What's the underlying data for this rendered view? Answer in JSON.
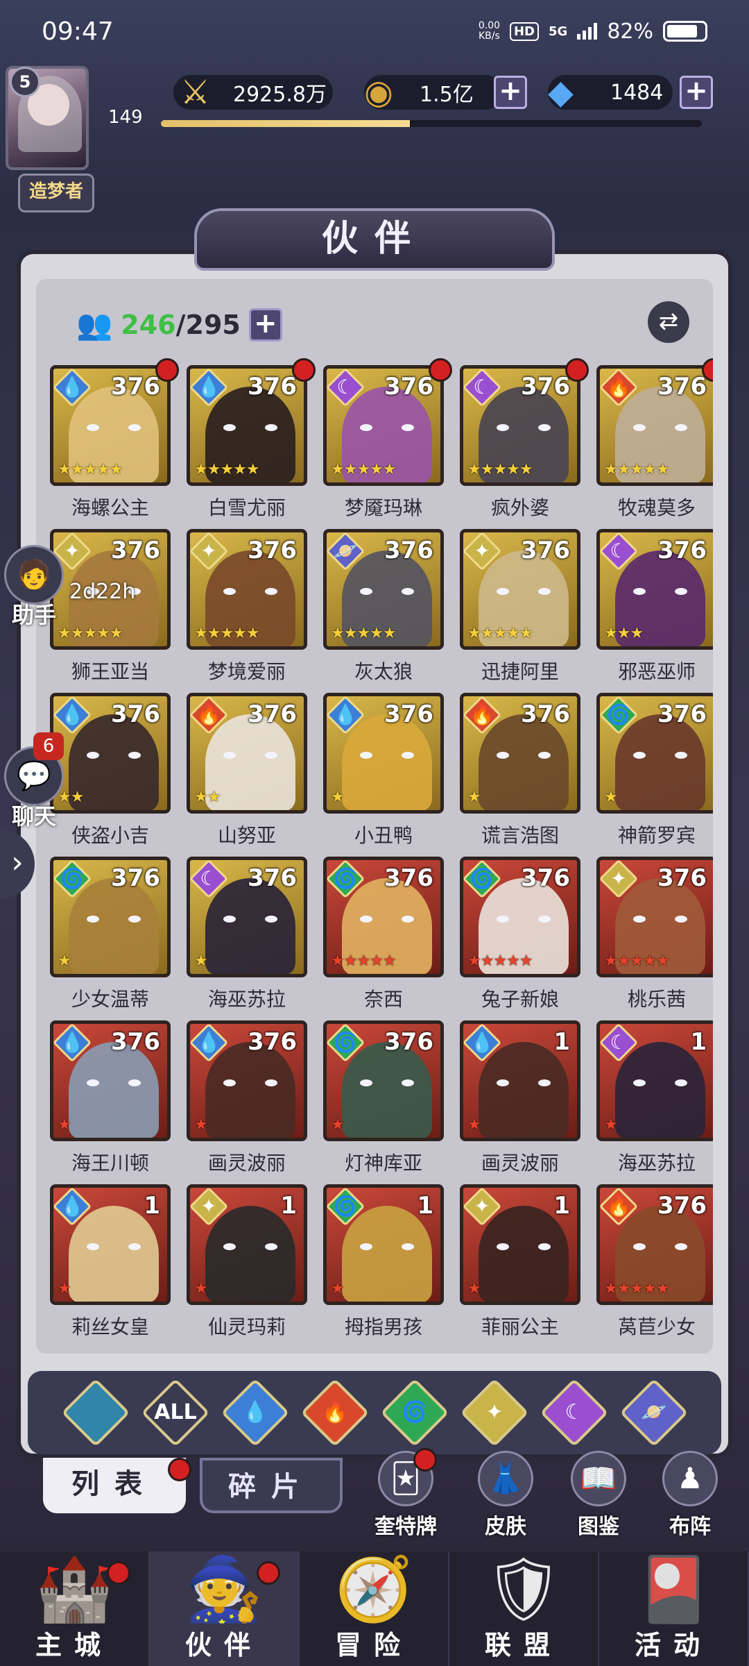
{
  "status_bar": {
    "time": "09:47",
    "speed_value": "0.00",
    "speed_unit": "KB/s",
    "hd": "HD",
    "network": "5G",
    "battery": "82%",
    "battery_level": 0.82
  },
  "player": {
    "level": "5",
    "xp_value": "149",
    "xp_progress": 0.46,
    "title": "造梦者"
  },
  "resources": {
    "power": "2925.8万",
    "gold": "1.5亿",
    "gems": "1484"
  },
  "panel": {
    "title": "伙伴",
    "owned": "246",
    "total": "/295"
  },
  "heroes": [
    {
      "name": "海螺公主",
      "level": "376",
      "stars": "★★★★★",
      "star_color": "y",
      "frame": "gold",
      "element": "water",
      "element_color": "#3d7fd6",
      "dot": true,
      "art": "#e0c07a"
    },
    {
      "name": "白雪尤丽",
      "level": "376",
      "stars": "★★★★★",
      "star_color": "y",
      "frame": "gold",
      "element": "water",
      "element_color": "#3d7fd6",
      "dot": true,
      "art": "#2a2020"
    },
    {
      "name": "梦魇玛琳",
      "level": "376",
      "stars": "★★★★★",
      "star_color": "y",
      "frame": "gold",
      "element": "dark",
      "element_color": "#9a4fd0",
      "dot": true,
      "art": "#9a55a6"
    },
    {
      "name": "疯外婆",
      "level": "376",
      "stars": "★★★★★",
      "star_color": "y",
      "frame": "gold",
      "element": "dark",
      "element_color": "#9a4fd0",
      "dot": true,
      "art": "#4a4450"
    },
    {
      "name": "牧魂莫多",
      "level": "376",
      "stars": "★★★★★",
      "star_color": "y",
      "frame": "gold",
      "element": "fire",
      "element_color": "#d8492b",
      "dot": true,
      "art": "#bfae96"
    },
    {
      "name": "狮王亚当",
      "level": "376",
      "stars": "★★★★★",
      "star_color": "y",
      "frame": "gold",
      "element": "light",
      "element_color": "#c9b44a",
      "dot": false,
      "art": "#a57a3d"
    },
    {
      "name": "梦境爱丽",
      "level": "376",
      "stars": "★★★★★",
      "star_color": "y",
      "frame": "gold",
      "element": "light",
      "element_color": "#c9b44a",
      "dot": false,
      "art": "#7a4a2a"
    },
    {
      "name": "灰太狼",
      "level": "376",
      "stars": "★★★★★",
      "star_color": "y",
      "frame": "gold",
      "element": "planet",
      "element_color": "#5f62c8",
      "dot": false,
      "art": "#555560"
    },
    {
      "name": "迅捷阿里",
      "level": "376",
      "stars": "★★★★★",
      "star_color": "y",
      "frame": "gold",
      "element": "light",
      "element_color": "#c9b44a",
      "dot": false,
      "art": "#cdb888"
    },
    {
      "name": "邪恶巫师",
      "level": "376",
      "stars": "★★★",
      "star_color": "y",
      "frame": "gold",
      "element": "dark",
      "element_color": "#9a4fd0",
      "dot": false,
      "art": "#5a2a6a"
    },
    {
      "name": "侠盗小吉",
      "level": "376",
      "stars": "★★",
      "star_color": "y",
      "frame": "gold",
      "element": "water",
      "element_color": "#3d7fd6",
      "dot": false,
      "art": "#3a2a2a"
    },
    {
      "name": "山努亚",
      "level": "376",
      "stars": "★★",
      "star_color": "y",
      "frame": "gold",
      "element": "fire",
      "element_color": "#d8492b",
      "dot": false,
      "art": "#e8e2d8"
    },
    {
      "name": "小丑鸭",
      "level": "376",
      "stars": "★",
      "star_color": "y",
      "frame": "gold",
      "element": "water",
      "element_color": "#3d7fd6",
      "dot": false,
      "art": "#d8a83a"
    },
    {
      "name": "谎言浩图",
      "level": "376",
      "stars": "★",
      "star_color": "y",
      "frame": "gold",
      "element": "fire",
      "element_color": "#d8492b",
      "dot": false,
      "art": "#6a4a2a"
    },
    {
      "name": "神箭罗宾",
      "level": "376",
      "stars": "★",
      "star_color": "y",
      "frame": "gold",
      "element": "wind",
      "element_color": "#2fa856",
      "dot": false,
      "art": "#6a3a2a"
    },
    {
      "name": "少女温蒂",
      "level": "376",
      "stars": "★",
      "star_color": "y",
      "frame": "gold",
      "element": "wind",
      "element_color": "#2fa856",
      "dot": false,
      "art": "#a8803a"
    },
    {
      "name": "海巫苏拉",
      "level": "376",
      "stars": "★",
      "star_color": "y",
      "frame": "gold",
      "element": "dark",
      "element_color": "#9a4fd0",
      "dot": false,
      "art": "#2a2438"
    },
    {
      "name": "奈西",
      "level": "376",
      "stars": "★★★★★",
      "star_color": "r",
      "frame": "red",
      "element": "wind",
      "element_color": "#2fa856",
      "dot": false,
      "art": "#e0b060"
    },
    {
      "name": "兔子新娘",
      "level": "376",
      "stars": "★★★★★",
      "star_color": "r",
      "frame": "red",
      "element": "wind",
      "element_color": "#2fa856",
      "dot": false,
      "art": "#e8e0d8"
    },
    {
      "name": "桃乐茜",
      "level": "376",
      "stars": "★★★★★",
      "star_color": "r",
      "frame": "red",
      "element": "light",
      "element_color": "#c9b44a",
      "dot": false,
      "art": "#a05a3a"
    },
    {
      "name": "海王川顿",
      "level": "376",
      "stars": "★",
      "star_color": "r",
      "frame": "red",
      "element": "water",
      "element_color": "#3d7fd6",
      "dot": false,
      "art": "#8a9ab0"
    },
    {
      "name": "画灵波丽",
      "level": "376",
      "stars": "★",
      "star_color": "r",
      "frame": "red",
      "element": "water",
      "element_color": "#3d7fd6",
      "dot": false,
      "art": "#4a2a24"
    },
    {
      "name": "灯神库亚",
      "level": "376",
      "stars": "★",
      "star_color": "r",
      "frame": "red",
      "element": "wind",
      "element_color": "#2fa856",
      "dot": false,
      "art": "#3a5a4a"
    },
    {
      "name": "画灵波丽",
      "level": "1",
      "stars": "★",
      "star_color": "r",
      "frame": "red",
      "element": "water",
      "element_color": "#3d7fd6",
      "dot": false,
      "art": "#4a2a24"
    },
    {
      "name": "海巫苏拉",
      "level": "1",
      "stars": "★",
      "star_color": "r",
      "frame": "red",
      "element": "dark",
      "element_color": "#9a4fd0",
      "dot": false,
      "art": "#2a2438"
    },
    {
      "name": "莉丝女皇",
      "level": "1",
      "stars": "★",
      "star_color": "r",
      "frame": "red",
      "element": "water",
      "element_color": "#3d7fd6",
      "dot": false,
      "art": "#e0c890"
    },
    {
      "name": "仙灵玛莉",
      "level": "1",
      "stars": "★",
      "star_color": "r",
      "frame": "red",
      "element": "light",
      "element_color": "#c9b44a",
      "dot": false,
      "art": "#2a2a2a"
    },
    {
      "name": "拇指男孩",
      "level": "1",
      "stars": "★",
      "star_color": "r",
      "frame": "red",
      "element": "wind",
      "element_color": "#2fa856",
      "dot": false,
      "art": "#c8a040"
    },
    {
      "name": "菲丽公主",
      "level": "1",
      "stars": "★",
      "star_color": "r",
      "frame": "red",
      "element": "light",
      "element_color": "#c9b44a",
      "dot": false,
      "art": "#3a2420"
    },
    {
      "name": "莴苣少女",
      "level": "376",
      "stars": "★★★★★",
      "star_color": "r",
      "frame": "red",
      "element": "fire",
      "element_color": "#d8492b",
      "dot": false,
      "art": "#8a4a2a"
    }
  ],
  "filters": [
    {
      "name": "filter-all-elements",
      "label": "",
      "color": "#2f86a8"
    },
    {
      "name": "filter-all",
      "label": "ALL",
      "color": "#3a3a52"
    },
    {
      "name": "filter-water",
      "label": "💧",
      "color": "#3d7fd6"
    },
    {
      "name": "filter-fire",
      "label": "🔥",
      "color": "#d8492b"
    },
    {
      "name": "filter-wind",
      "label": "🌀",
      "color": "#2fa856"
    },
    {
      "name": "filter-light",
      "label": "✦",
      "color": "#c9b44a"
    },
    {
      "name": "filter-dark",
      "label": "☾",
      "color": "#9a4fd0"
    },
    {
      "name": "filter-planet",
      "label": "🪐",
      "color": "#5f62c8"
    }
  ],
  "subtabs": {
    "list": "列表",
    "fragments": "碎片"
  },
  "side_buttons": {
    "tarot": "奎特牌",
    "skin": "皮肤",
    "codex": "图鉴",
    "formation": "布阵"
  },
  "floating": {
    "assistant": "助手",
    "assistant_timer": "2d22h",
    "chat": "聊天",
    "chat_count": "6"
  },
  "nav": {
    "city": "主城",
    "partner": "伙伴",
    "adventure": "冒险",
    "alliance": "联盟",
    "events": "活动"
  }
}
